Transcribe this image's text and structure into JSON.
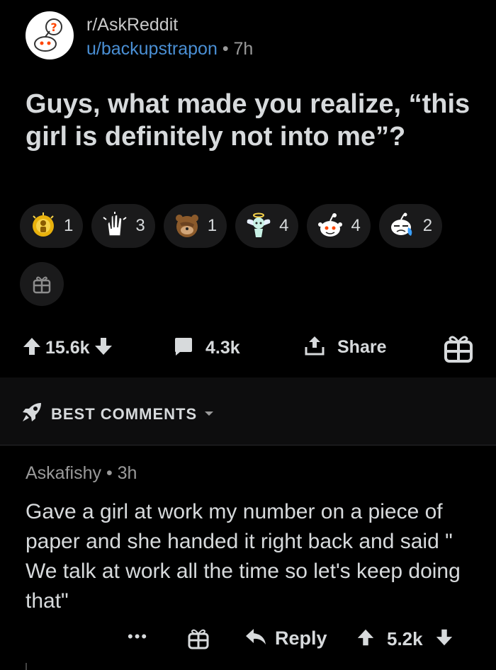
{
  "post": {
    "subreddit": "r/AskReddit",
    "username": "u/backupstrapon",
    "separator": "•",
    "age": "7h",
    "avatar_icon": "askreddit-snoo-icon",
    "title": "Guys, what made you realize, “this girl is definitely not into me”?"
  },
  "awards": [
    {
      "icon": "gold-award-icon",
      "count": "1"
    },
    {
      "icon": "clapping-hands-award-icon",
      "count": "3"
    },
    {
      "icon": "facepalm-bear-award-icon",
      "count": "1"
    },
    {
      "icon": "angel-award-icon",
      "count": "4"
    },
    {
      "icon": "silver-snoo-award-icon",
      "count": "4"
    },
    {
      "icon": "crying-snoo-award-icon",
      "count": "2"
    }
  ],
  "actions": {
    "score": "15.6k",
    "comments": "4.3k",
    "share_label": "Share"
  },
  "sort": {
    "label": "BEST COMMENTS"
  },
  "comment": {
    "author": "Askafishy",
    "separator": "•",
    "age": "3h",
    "body": "Gave a girl at work my number on a piece of paper and she handed it right back and said \" We talk at work all the time so let's keep doing that\"",
    "more_label": "•••",
    "reply_label": "Reply",
    "score": "5.2k"
  },
  "colors": {
    "background": "#000000",
    "username_link": "#4a8fd4",
    "chip": "#1a1a1b",
    "text": "#d7dadc",
    "muted": "#9a9a9a"
  }
}
